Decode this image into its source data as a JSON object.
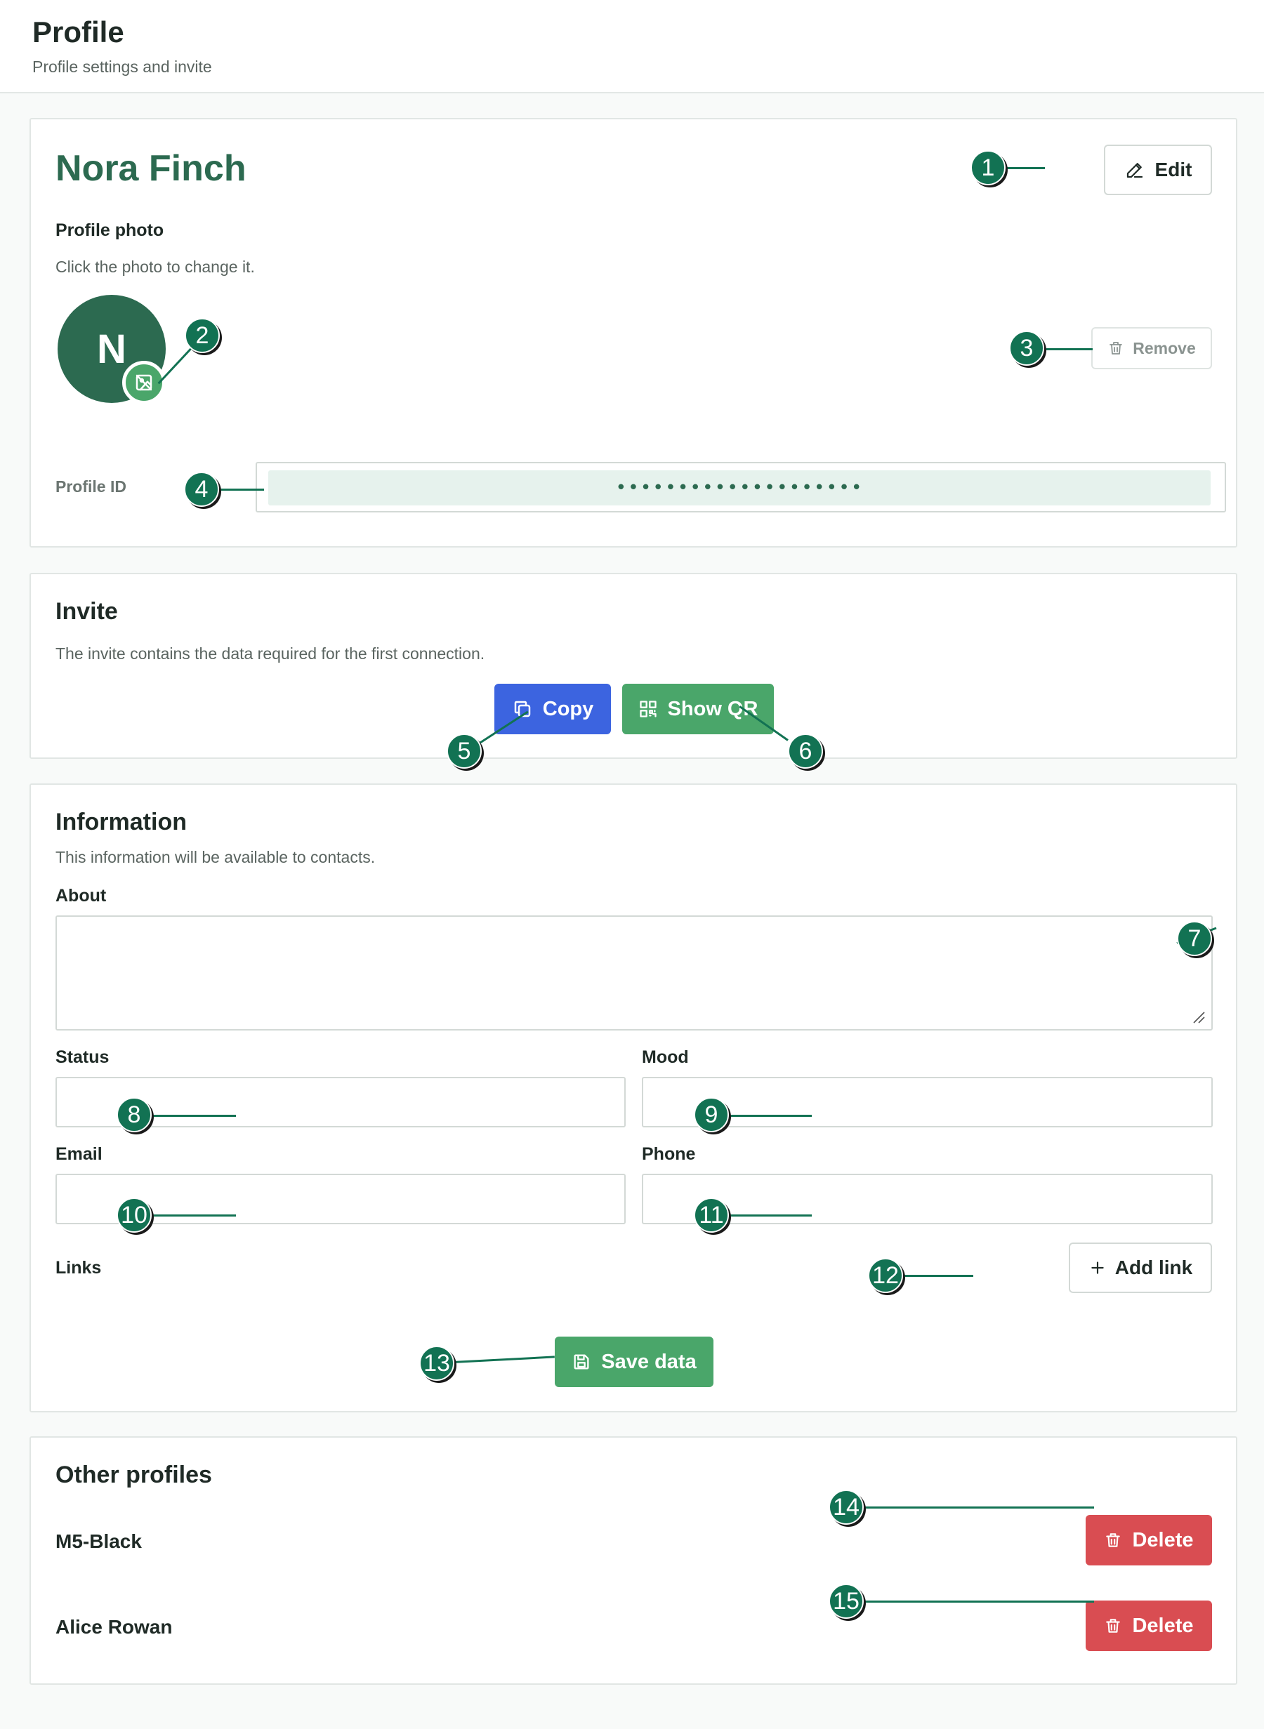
{
  "header": {
    "title": "Profile",
    "subtitle": "Profile settings and invite"
  },
  "profile": {
    "name": "Nora Finch",
    "edit_label": "Edit",
    "photo_label": "Profile photo",
    "photo_hint": "Click the photo to change it.",
    "avatar_initial": "N",
    "remove_label": "Remove",
    "id_label": "Profile ID",
    "id_value": "••••••••••••••••••••"
  },
  "invite": {
    "title": "Invite",
    "description": "The invite contains the data required for the first connection.",
    "copy_label": "Copy",
    "show_qr_label": "Show QR"
  },
  "information": {
    "title": "Information",
    "description": "This information will be available to contacts.",
    "about_label": "About",
    "about_value": "",
    "status_label": "Status",
    "status_value": "",
    "mood_label": "Mood",
    "mood_value": "",
    "email_label": "Email",
    "email_value": "",
    "phone_label": "Phone",
    "phone_value": "",
    "links_label": "Links",
    "add_link_label": "Add link",
    "save_label": "Save data"
  },
  "other_profiles": {
    "title": "Other profiles",
    "items": [
      {
        "name": "M5-Black",
        "delete_label": "Delete"
      },
      {
        "name": "Alice Rowan",
        "delete_label": "Delete"
      }
    ]
  },
  "markers": [
    "1",
    "2",
    "3",
    "4",
    "5",
    "6",
    "7",
    "8",
    "9",
    "10",
    "11",
    "12",
    "13",
    "14",
    "15"
  ],
  "colors": {
    "brand_green": "#2c6a50",
    "button_green": "#4aa66a",
    "button_blue": "#3c64e0",
    "button_red": "#d94d52",
    "marker_green": "#127253"
  }
}
